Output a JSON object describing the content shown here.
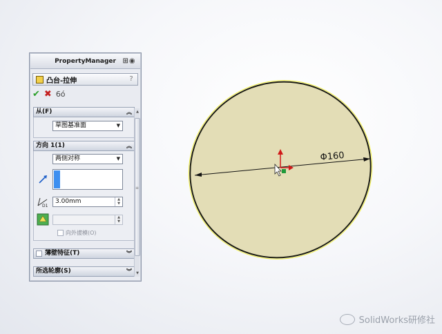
{
  "property_manager": {
    "title": "PropertyManager",
    "feature_title": "凸台-拉伸",
    "help_label": "?",
    "actions": {
      "ok": "✔",
      "cancel": "✖",
      "preview": "6ó"
    },
    "from_group": {
      "label": "从(F)",
      "start_condition": "草图基准面"
    },
    "direction1_group": {
      "label": "方向 1(1)",
      "end_condition": "两侧对称",
      "depth": "3.00mm",
      "draft_outward_label": "向外拔模(O)"
    },
    "thin_feature_label": "薄壁特征(T)",
    "selected_contours_label": "所选轮廓(S)"
  },
  "viewport": {
    "dimension_label": "Φ160",
    "circle_fill": "#e3ddb6",
    "circle_stroke": "#1b1b10",
    "highlight_color": "#f3ef2a",
    "watermark_text": "SolidWorks研修社"
  }
}
